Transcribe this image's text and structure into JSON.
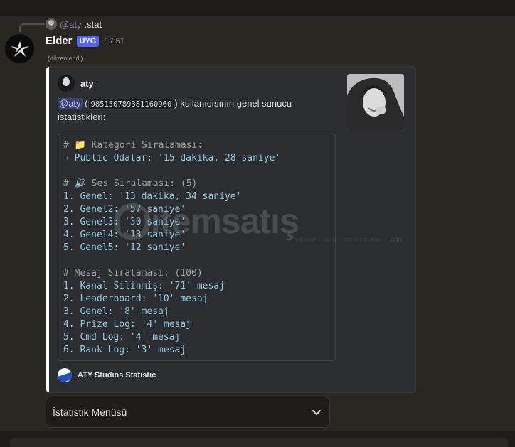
{
  "reply": {
    "mention": "@aty",
    "text": ".stat"
  },
  "message": {
    "username": "Elder",
    "badge": "UYG",
    "timestamp": "17:51",
    "edited": "(düzenlendi)"
  },
  "embed": {
    "author": "aty",
    "description": {
      "mention": "@aty",
      "open_paren": "(",
      "user_id": "985150789381160960",
      "close_text": ") kullanıcısının genel sunucu istatistikleri:"
    },
    "code_lines": [
      "# 📁 Kategori Sıralaması:",
      "→ Public Odalar: '15 dakika, 28 saniye'",
      "",
      "# 🔊 Ses Sıralaması: (5)",
      "1. Genel: '13 dakika, 34 saniye'",
      "2. Genel2: '57 saniye'",
      "3. Genel3: '30 saniye'",
      "4. Genel4: '13 saniye'",
      "5. Genel5: '12 saniye'",
      "",
      "# Mesaj Sıralaması: (100)",
      "1. Kanal Silinmiş: '71' mesaj",
      "2. Leaderboard: '10' mesaj",
      "3. Genel: '8' mesaj",
      "4. Prize Log: '4' mesaj",
      "5. Cmd Log: '4' mesaj",
      "6. Rank Log: '3' mesaj"
    ],
    "footer": "ATY Studios Statistic"
  },
  "select_menu": {
    "placeholder": "İstatistik Menüsü"
  },
  "watermark": {
    "brand": "itemsatış",
    "sub": "HESAP / SKIN / ITEM / E-PIN",
    "domain": ".com"
  },
  "colors": {
    "accent": "#5865f2",
    "embed_bar": "#ffffff",
    "code_text": "#8fc6e0"
  }
}
